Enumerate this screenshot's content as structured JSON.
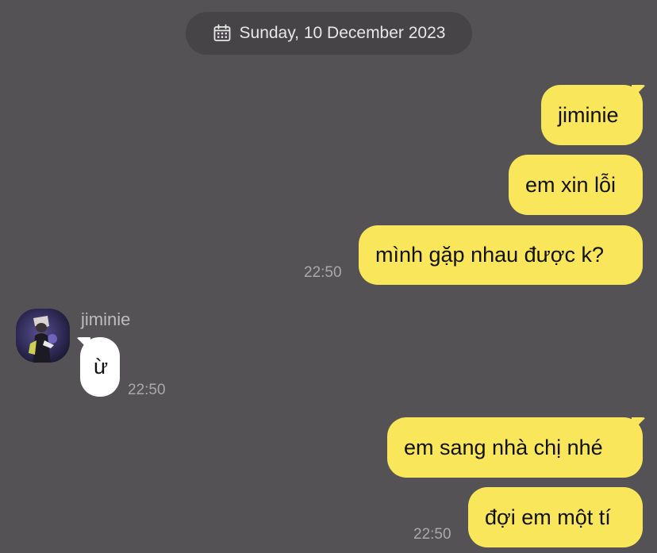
{
  "date_label": "Sunday, 10 December 2023",
  "icons": {
    "date": "calendar-icon",
    "avatar": "profile-photo"
  },
  "colors": {
    "background": "#545254",
    "date_pill": "#464446",
    "outgoing_bubble": "#fae65a",
    "incoming_bubble": "#ffffff",
    "timestamp": "#a9a9a9"
  },
  "messages": [
    {
      "direction": "outgoing",
      "text": "jiminie"
    },
    {
      "direction": "outgoing",
      "text": "em xin lỗi"
    },
    {
      "direction": "outgoing",
      "text": "mình gặp nhau được k?",
      "time": "22:50"
    },
    {
      "direction": "incoming",
      "sender": "jiminie",
      "text": "ừ",
      "time": "22:50"
    },
    {
      "direction": "outgoing",
      "text": "em sang nhà chị nhé"
    },
    {
      "direction": "outgoing",
      "text": "đợi em một tí",
      "time": "22:50"
    }
  ]
}
